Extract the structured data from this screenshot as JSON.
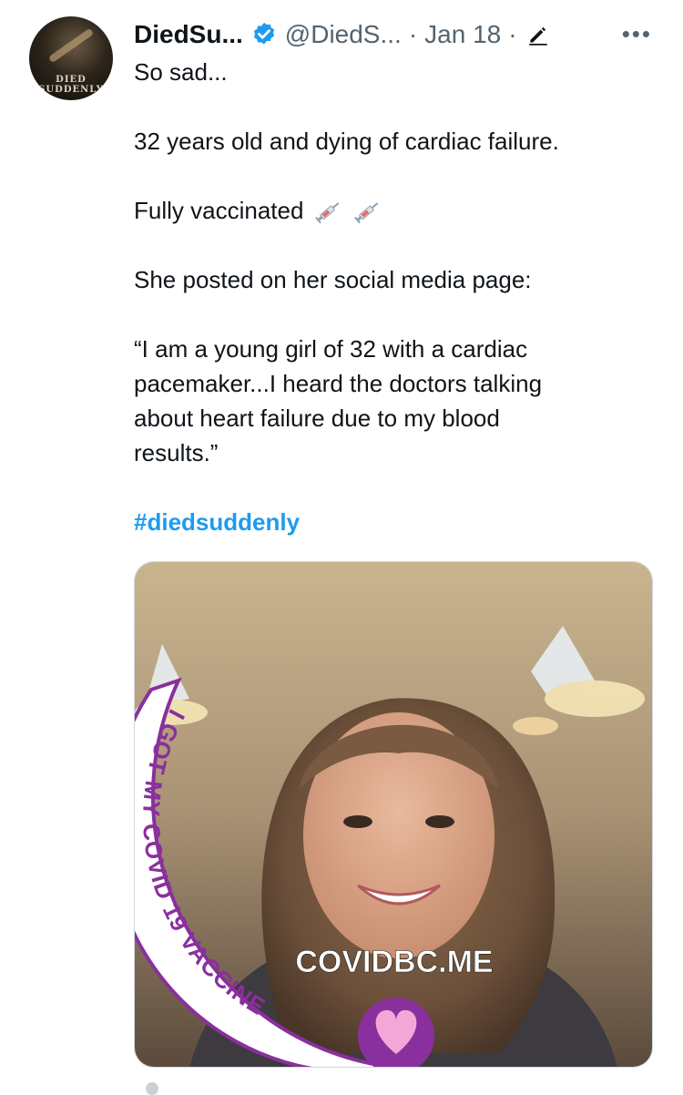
{
  "tweet": {
    "display_name": "DiedSu...",
    "handle": "@DiedS...",
    "separator": "·",
    "date": "Jan 18",
    "separator2": "·",
    "more_label": "•••",
    "avatar_text": "DIED SUDDENLY",
    "lines": [
      "So sad...",
      "32 years old and dying of cardiac failure.",
      "Fully vaccinated",
      "She posted on her social media page:",
      "“I am a young girl of 32 with a cardiac",
      "pacemaker...I heard the doctors talking",
      "about heart failure due to my blood",
      "results.”"
    ],
    "hashtag": "#diedsuddenly",
    "icons": {
      "verified": "verified-badge-icon",
      "edit": "pencil-icon",
      "syringe": "syringe-emoji-icon"
    },
    "colors": {
      "hashtag": "#1d9bf0",
      "verified": "#1d9bf0",
      "muted": "#536471",
      "frame_purple": "#8a2f9e"
    }
  },
  "media": {
    "frame_text": "I GOT MY COVID 19 VACCINE",
    "site_text": "COVIDBC.ME"
  }
}
